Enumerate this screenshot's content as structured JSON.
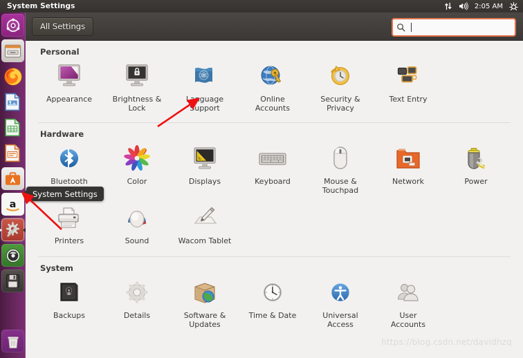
{
  "panel": {
    "title": "System Settings",
    "clock": "2:05 AM",
    "indicators": [
      "network-updown-icon",
      "volume-icon",
      "session-gear-icon"
    ]
  },
  "launcher": {
    "items": [
      {
        "name": "dash-home",
        "label": "Dash Home"
      },
      {
        "name": "files",
        "label": "Files"
      },
      {
        "name": "firefox",
        "label": "Firefox Web Browser"
      },
      {
        "name": "libreoffice-writer",
        "label": "LibreOffice Writer"
      },
      {
        "name": "libreoffice-calc",
        "label": "LibreOffice Calc"
      },
      {
        "name": "libreoffice-impress",
        "label": "LibreOffice Impress"
      },
      {
        "name": "ubuntu-software",
        "label": "Ubuntu Software"
      },
      {
        "name": "amazon",
        "label": "Amazon"
      },
      {
        "name": "system-settings",
        "label": "System Settings"
      },
      {
        "name": "software-updater",
        "label": "Software Updater"
      },
      {
        "name": "disks",
        "label": "Disks"
      }
    ],
    "trash": {
      "name": "trash",
      "label": "Trash"
    }
  },
  "toolbar": {
    "all_settings_label": "All Settings",
    "search_placeholder": "",
    "search_value": "",
    "search_icon": "search-icon"
  },
  "tooltip": {
    "text": "System Settings"
  },
  "watermark": "https://blog.csdn.net/davidhzq",
  "sections": [
    {
      "title": "Personal",
      "items": [
        {
          "label": "Appearance",
          "icon": "appearance-icon"
        },
        {
          "label": "Brightness &\nLock",
          "icon": "brightness-lock-icon"
        },
        {
          "label": "Language\nSupport",
          "icon": "language-support-icon"
        },
        {
          "label": "Online\nAccounts",
          "icon": "online-accounts-icon"
        },
        {
          "label": "Security &\nPrivacy",
          "icon": "security-privacy-icon"
        },
        {
          "label": "Text Entry",
          "icon": "text-entry-icon"
        }
      ]
    },
    {
      "title": "Hardware",
      "items": [
        {
          "label": "Bluetooth",
          "icon": "bluetooth-icon"
        },
        {
          "label": "Color",
          "icon": "color-icon"
        },
        {
          "label": "Displays",
          "icon": "displays-icon"
        },
        {
          "label": "Keyboard",
          "icon": "keyboard-icon"
        },
        {
          "label": "Mouse &\nTouchpad",
          "icon": "mouse-touchpad-icon"
        },
        {
          "label": "Network",
          "icon": "network-icon"
        },
        {
          "label": "Power",
          "icon": "power-icon"
        },
        {
          "label": "Printers",
          "icon": "printers-icon"
        },
        {
          "label": "Sound",
          "icon": "sound-icon"
        },
        {
          "label": "Wacom Tablet",
          "icon": "wacom-tablet-icon"
        }
      ]
    },
    {
      "title": "System",
      "items": [
        {
          "label": "Backups",
          "icon": "backups-icon"
        },
        {
          "label": "Details",
          "icon": "details-icon"
        },
        {
          "label": "Software &\nUpdates",
          "icon": "software-updates-icon"
        },
        {
          "label": "Time & Date",
          "icon": "time-date-icon"
        },
        {
          "label": "Universal\nAccess",
          "icon": "universal-access-icon"
        },
        {
          "label": "User\nAccounts",
          "icon": "user-accounts-icon"
        }
      ]
    }
  ],
  "colors": {
    "launcher": "#6a2760",
    "panel": "#3f3b37",
    "content_bg": "#f2f1f0",
    "accent_orange": "#e2734a",
    "annotation_red": "#ee1111"
  }
}
